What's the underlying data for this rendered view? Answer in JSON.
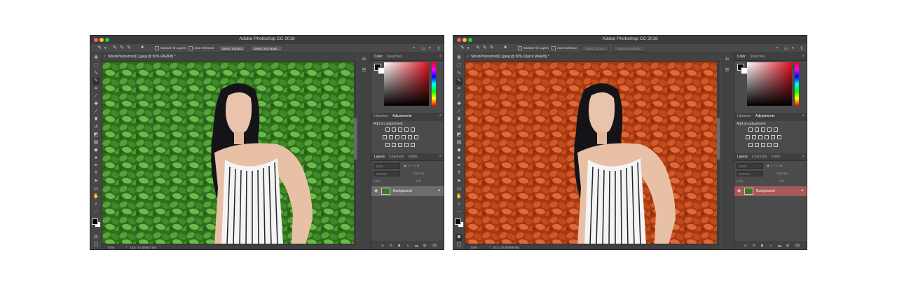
{
  "left": {
    "window_title": "Adobe Photoshop CC 2018",
    "options": {
      "sample_all_layers": "Sample All Layers",
      "auto_enhance": "Auto-Enhance",
      "select_subject": "Select Subject",
      "select_and_mask": "Select and Mask..."
    },
    "doc_tab": "ShrubPhotoshoot(1).jpeg @ 50% (RGB/8) *",
    "status_zoom": "50%",
    "status_doc": "Doc: 67.5M/67.5M",
    "panels": {
      "color_tabs": [
        "Color",
        "Swatches"
      ],
      "adj_tabs": [
        "Libraries",
        "Adjustments"
      ],
      "adj_title": "Add an adjustment",
      "layer_tabs": [
        "Layers",
        "Channels",
        "Paths"
      ],
      "layer_kind": "Kind",
      "blend_mode": "Normal",
      "opacity_label": "Opacity:",
      "lock_label": "Lock:",
      "fill_label": "Fill:",
      "layer_name": "Background"
    }
  },
  "right": {
    "window_title": "Adobe Photoshop CC 2018",
    "options": {
      "sample_all_layers": "Sample All Layers",
      "auto_enhance": "Auto-Enhance",
      "select_subject": "Select Subject",
      "select_and_mask": "Select and Mask..."
    },
    "doc_tab": "ShrubPhotoshoot(1).jpeg @ 50% (Quick Mask/8) *",
    "status_zoom": "50%",
    "status_doc": "Doc: 67.5M/89.9M",
    "panels": {
      "color_tabs": [
        "Color",
        "Swatches"
      ],
      "adj_tabs": [
        "Libraries",
        "Adjustments"
      ],
      "adj_title": "Add an adjustment",
      "layer_tabs": [
        "Layers",
        "Channels",
        "Paths"
      ],
      "layer_kind": "Kind",
      "blend_mode": "Normal",
      "opacity_label": "Opacity:",
      "lock_label": "Lock:",
      "fill_label": "Fill:",
      "layer_name": "Background"
    }
  },
  "colors": {
    "leaf_green": "#3d8a23",
    "quick_mask_red": "#c14416",
    "active_layer_quickmask": "#a85858"
  }
}
